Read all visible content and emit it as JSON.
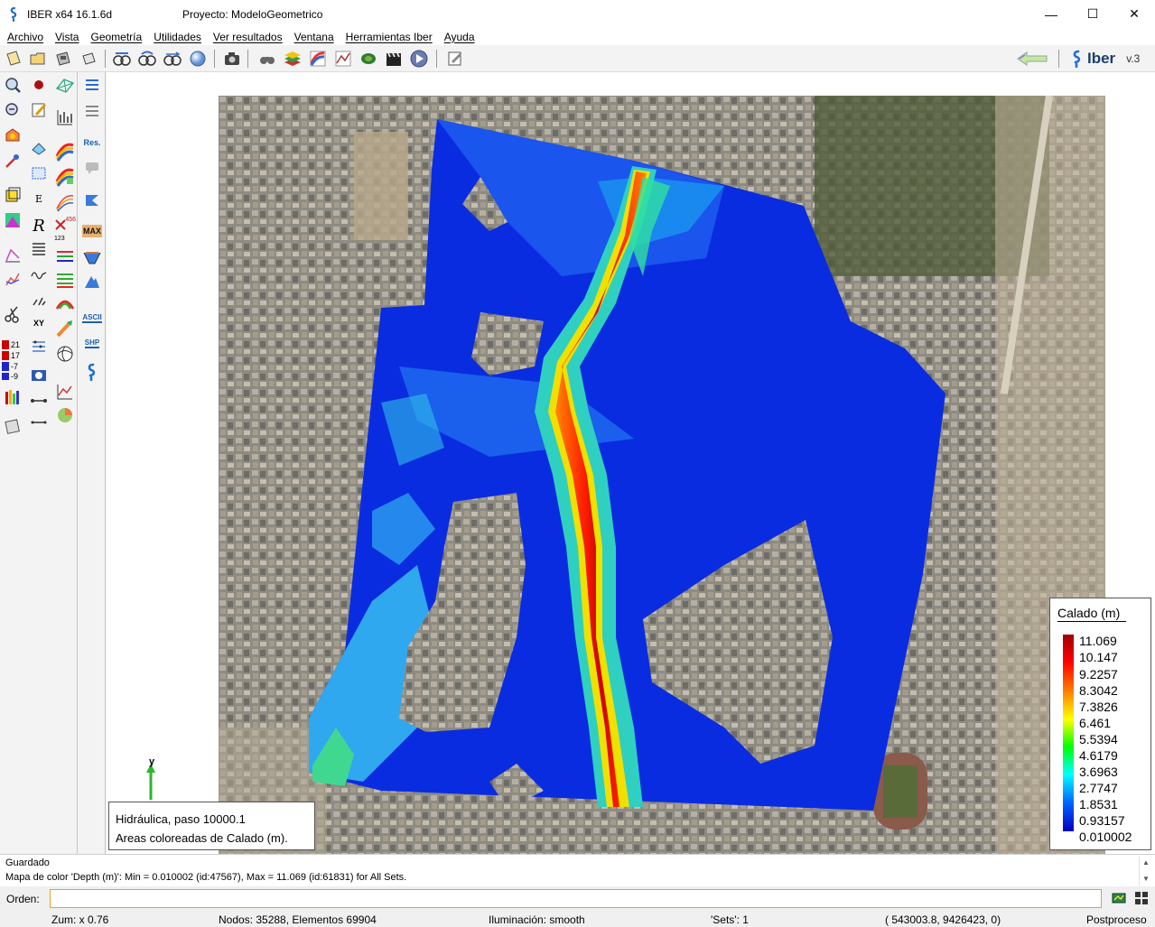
{
  "window": {
    "app_title": "IBER x64 16.1.6d",
    "project_title": "Proyecto: ModeloGeometrico",
    "minimize_glyph": "—",
    "maximize_glyph": "☐",
    "close_glyph": "✕"
  },
  "menu": [
    {
      "label": "Archivo"
    },
    {
      "label": "Vista"
    },
    {
      "label": "Geometría"
    },
    {
      "label": "Utilidades"
    },
    {
      "label": "Ver resultados"
    },
    {
      "label": "Ventana"
    },
    {
      "label": "Herramientas Iber"
    },
    {
      "label": "Ayuda"
    }
  ],
  "toolbar": {
    "brand_name": "Iber",
    "brand_version": "v.3"
  },
  "palette": {
    "res_label": "Res.",
    "max_label": "MAX",
    "ascii_label": "ASCII",
    "shp_label": "SHP",
    "xy_label": "XY",
    "r_label": "R",
    "e_label": "E",
    "num_label": "456",
    "num2_label": "123",
    "tick_21": "21",
    "tick_17": "17",
    "tick_7": "-7",
    "tick_9": "-9"
  },
  "canvas": {
    "axis_label": "y",
    "result_line1": "Hidráulica, paso 10000.1",
    "result_line2": "Areas coloreadas de Calado (m).",
    "legend": {
      "title": "Calado (m)",
      "labels": [
        "11.069",
        "10.147",
        "9.2257",
        "8.3042",
        "7.3826",
        "6.461",
        "5.5394",
        "4.6179",
        "3.6963",
        "2.7747",
        "1.8531",
        "0.93157",
        "0.010002"
      ],
      "colors": [
        "#a00000",
        "#ff0000",
        "#ff8000",
        "#ffff00",
        "#00ff00",
        "#00ffff",
        "#0060ff",
        "#0000c0"
      ]
    }
  },
  "messages": {
    "line1": "Guardado",
    "line2": "Mapa de color 'Depth (m)': Min = 0.010002 (id:47567), Max = 11.069 (id:61831) for All Sets."
  },
  "command": {
    "label": "Orden:",
    "value": ""
  },
  "status": {
    "zoom": "Zum: x 0.76",
    "mesh": "Nodos: 35288, Elementos 69904",
    "lighting": "Iluminación: smooth",
    "sets": "'Sets': 1",
    "coords": "( 543003.8,  9426423,  0)",
    "mode": "Postproceso"
  }
}
